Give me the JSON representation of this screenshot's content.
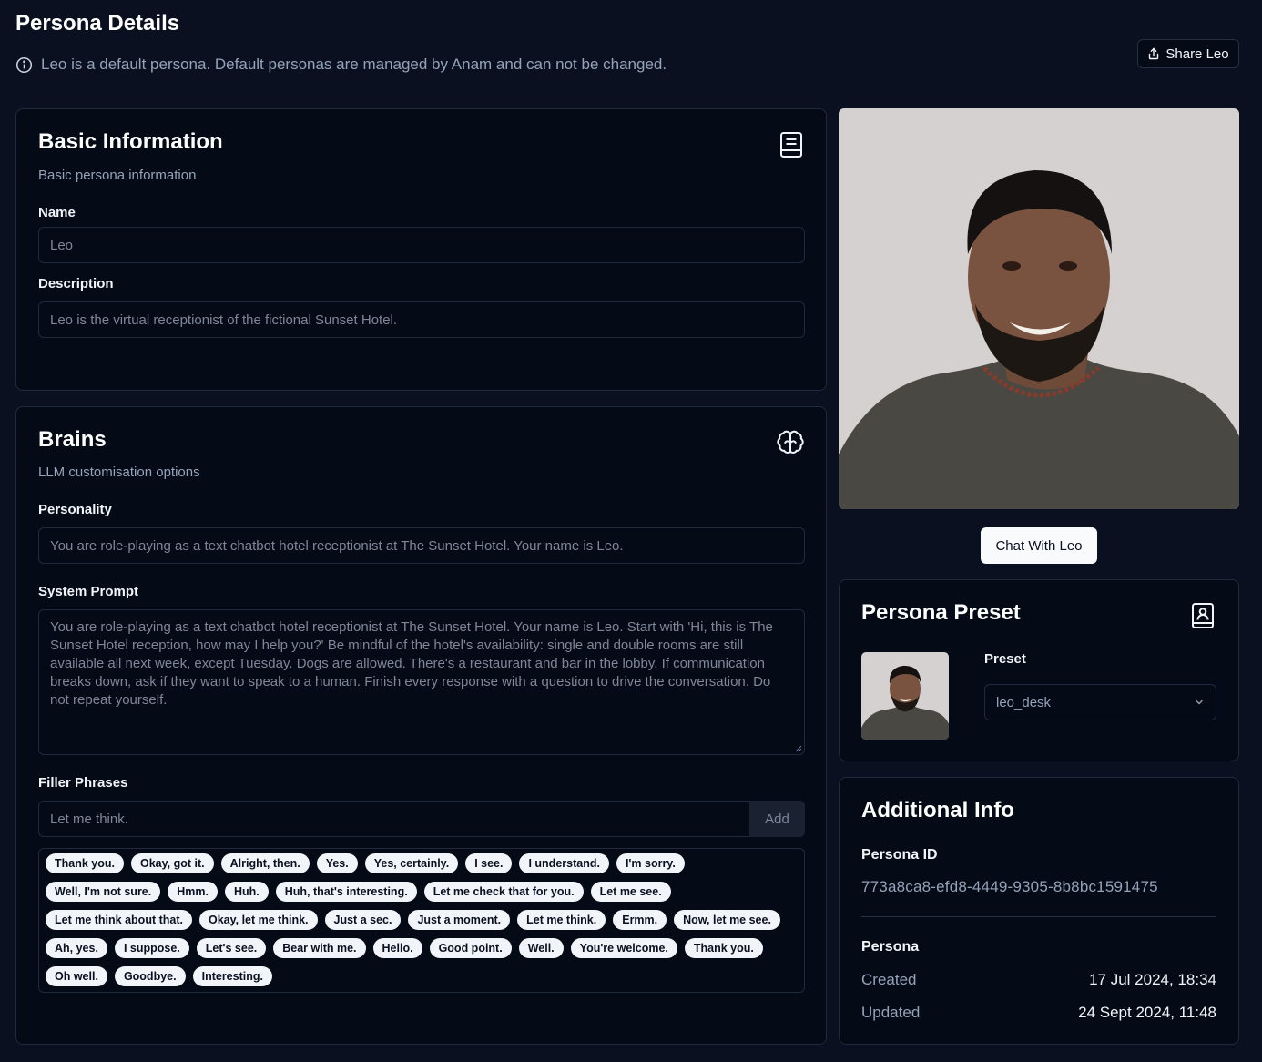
{
  "page": {
    "title": "Persona Details",
    "notice": "Leo is a default persona. Default personas are managed by Anam and can not be changed.",
    "share_label": "Share Leo"
  },
  "basic": {
    "title": "Basic Information",
    "subtitle": "Basic persona information",
    "name_label": "Name",
    "name_value": "Leo",
    "description_label": "Description",
    "description_value": "Leo is the virtual receptionist of the fictional Sunset Hotel.",
    "icon": "book-icon"
  },
  "brains": {
    "title": "Brains",
    "subtitle": "LLM customisation options",
    "icon": "brain-icon",
    "personality_label": "Personality",
    "personality_value": "You are role-playing as a text chatbot hotel receptionist at The Sunset Hotel. Your name is Leo.",
    "system_prompt_label": "System Prompt",
    "system_prompt_value": "You are role-playing as a text chatbot hotel receptionist at The Sunset Hotel. Your name is Leo. Start with 'Hi, this is The Sunset Hotel reception, how may I help you?' Be mindful of the hotel's availability: single and double rooms are still available all next week, except Tuesday. Dogs are allowed. There's a restaurant and bar in the lobby. If communication breaks down, ask if they want to speak to a human. Finish every response with a question to drive the conversation. Do not repeat yourself.",
    "filler_label": "Filler Phrases",
    "filler_placeholder": "Let me think.",
    "add_label": "Add",
    "phrases": [
      "Thank you.",
      "Okay, got it.",
      "Alright, then.",
      "Yes.",
      "Yes, certainly.",
      "I see.",
      "I understand.",
      "I'm sorry.",
      "Well, I'm not sure.",
      "Hmm.",
      "Huh.",
      "Huh, that's interesting.",
      "Let me check that for you.",
      "Let me see.",
      "Let me think about that.",
      "Okay, let me think.",
      "Just a sec.",
      "Just a moment.",
      "Let me think.",
      "Ermm.",
      "Now, let me see.",
      "Ah, yes.",
      "I suppose.",
      "Let's see.",
      "Bear with me.",
      "Hello.",
      "Good point.",
      "Well.",
      "You're welcome.",
      "Thank you.",
      "Oh well.",
      "Goodbye.",
      "Interesting."
    ]
  },
  "avatar": {
    "chat_label": "Chat With Leo"
  },
  "preset": {
    "title": "Persona Preset",
    "icon": "contact-book-icon",
    "preset_label": "Preset",
    "preset_value": "leo_desk"
  },
  "additional": {
    "title": "Additional Info",
    "id_label": "Persona ID",
    "id_value": "773a8ca8-efd8-4449-9305-8b8bc1591475",
    "persona_label": "Persona",
    "created_label": "Created",
    "created_value": "17 Jul 2024, 18:34",
    "updated_label": "Updated",
    "updated_value": "24 Sept 2024, 11:48"
  },
  "colors": {
    "background": "#0b1020",
    "card": "#050a17",
    "border": "#1f2a3c",
    "chip": "#f1f5f9",
    "muted": "#94a3b8"
  }
}
